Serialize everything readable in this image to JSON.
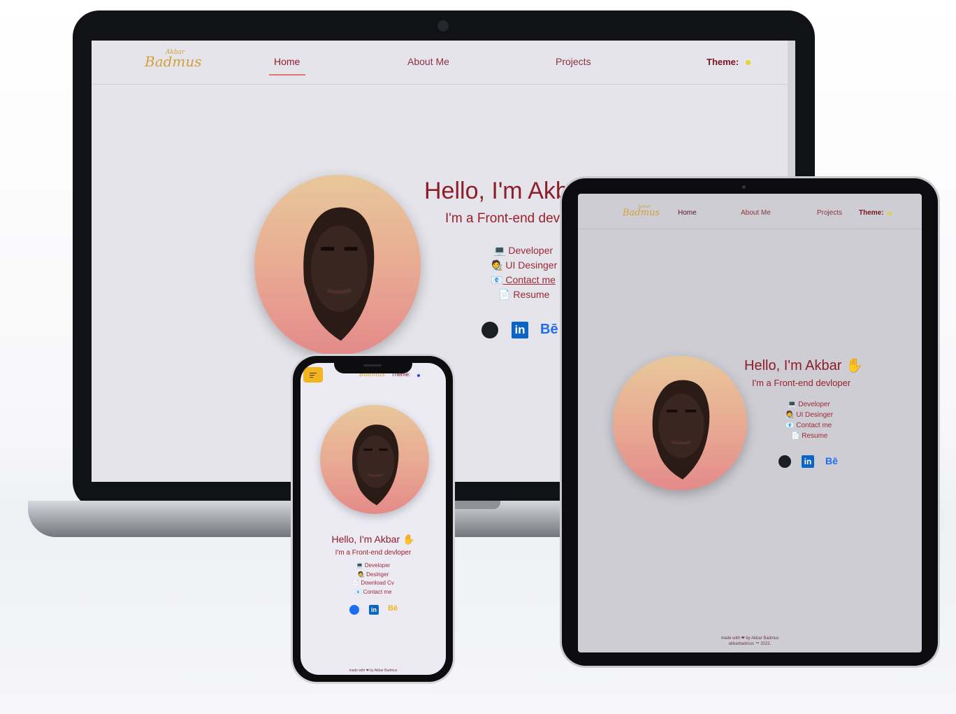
{
  "site": {
    "logo_main": "Badmus",
    "logo_small": "Akbar",
    "nav": [
      "Home",
      "About Me",
      "Projects"
    ],
    "theme_label": "Theme:",
    "greeting": "Hello, I'm Akbar",
    "greeting_emoji": "✋",
    "subtitle": "I'm a Front-end devloper",
    "links_desktop": [
      {
        "icon": "💻",
        "label": "Developer"
      },
      {
        "icon": "🧑‍🎨",
        "label": "UI Desinger"
      },
      {
        "icon": "📧",
        "label": "Contact me"
      },
      {
        "icon": "📄",
        "label": "Resume"
      }
    ],
    "links_mobile": [
      {
        "icon": "💻",
        "label": "Developer"
      },
      {
        "icon": "🧑‍🎨",
        "label": "Desinger"
      },
      {
        "icon": "📄",
        "label": "Download Cv"
      },
      {
        "icon": "📧",
        "label": "Contact me"
      }
    ],
    "social": {
      "github": "github-icon",
      "linkedin": "in",
      "behance": "Bē"
    },
    "footer_line1": "made with ❤ by Akbar Badmus",
    "footer_line2": "akbarbadmus ™ 2022."
  },
  "laptop": {
    "greeting_visible": "Hello, I'm Akb",
    "subtitle_visible": "I'm a Front-end dev"
  },
  "colors": {
    "accent": "#8e1d2a",
    "logo": "#d2a13a",
    "theme_dot": "#e6d22a",
    "menu_button": "#f2b51e"
  }
}
